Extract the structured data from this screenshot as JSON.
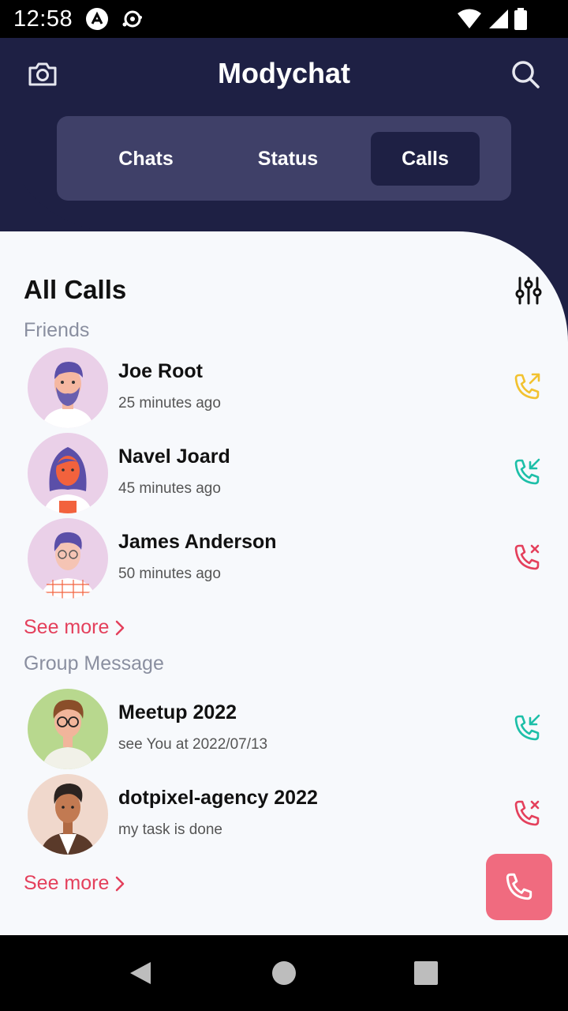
{
  "status_bar": {
    "time": "12:58"
  },
  "app": {
    "title": "Modychat"
  },
  "tabs": [
    {
      "label": "Chats",
      "active": false
    },
    {
      "label": "Status",
      "active": false
    },
    {
      "label": "Calls",
      "active": true
    }
  ],
  "calls": {
    "title": "All Calls",
    "friends_label": "Friends",
    "friends": [
      {
        "name": "Joe Root",
        "time": "25 minutes ago",
        "call_type": "outgoing",
        "color": "#f2c230"
      },
      {
        "name": "Navel Joard",
        "time": "45 minutes ago",
        "call_type": "incoming",
        "color": "#1dbfa8"
      },
      {
        "name": "James Anderson",
        "time": "50 minutes ago",
        "call_type": "missed",
        "color": "#e4405c"
      }
    ],
    "see_more_1": "See more",
    "group_label": "Group Message",
    "groups": [
      {
        "name": "Meetup 2022",
        "message": "see You at 2022/07/13",
        "call_type": "incoming",
        "color": "#1dbfa8"
      },
      {
        "name": "dotpixel-agency 2022",
        "message": "my task is done",
        "call_type": "missed",
        "color": "#e4405c"
      }
    ],
    "see_more_2": "See more"
  },
  "colors": {
    "header": "#1e2044",
    "tab_bar": "#3f4068",
    "accent": "#e4405c",
    "fab": "#f06b7f"
  }
}
